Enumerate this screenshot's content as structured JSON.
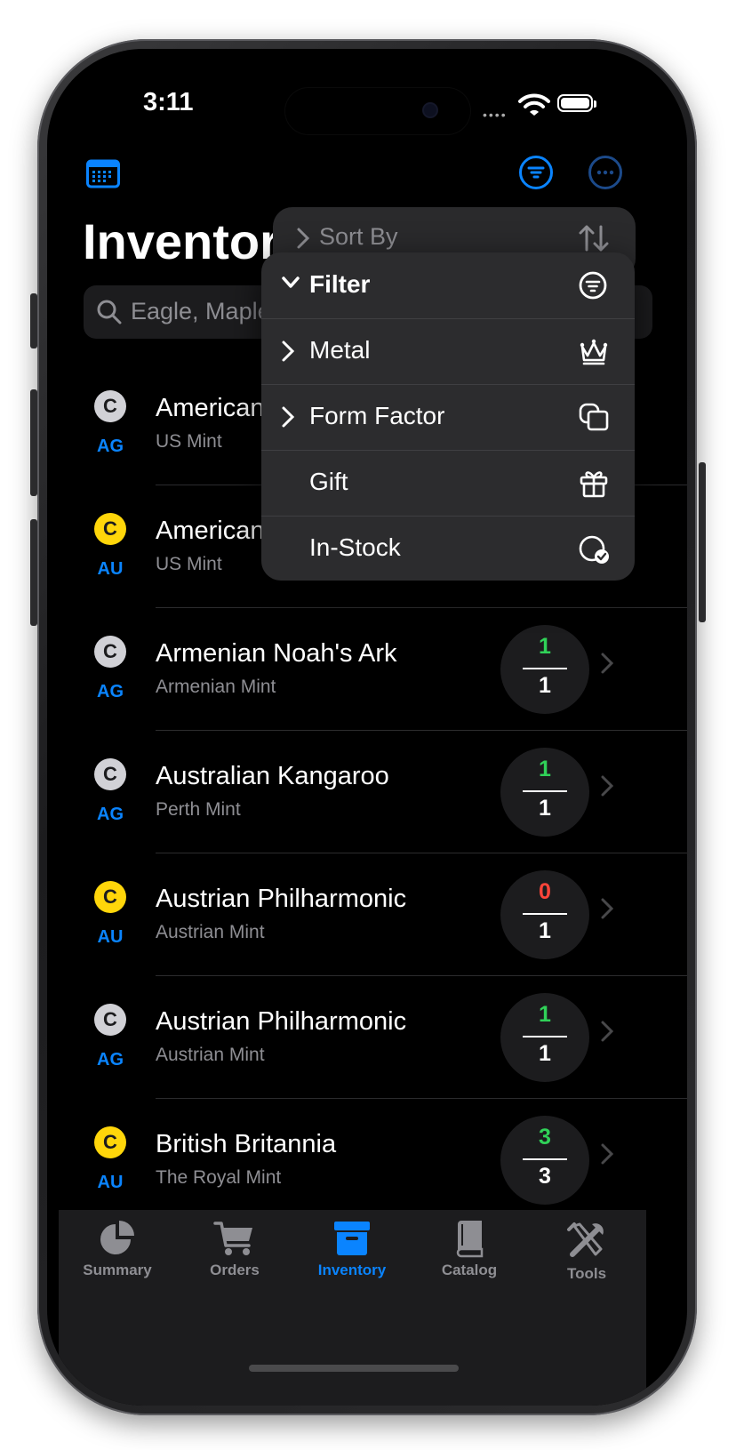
{
  "status": {
    "time": "3:11",
    "dots": "••••"
  },
  "header": {
    "title": "Inventory",
    "search_placeholder": "Eagle, Maple"
  },
  "menu": {
    "sort_label": "Sort By",
    "items": [
      {
        "label": "Filter",
        "icon": "filter-circle-icon"
      },
      {
        "label": "Metal",
        "icon": "crown-icon"
      },
      {
        "label": "Form Factor",
        "icon": "squares-icon"
      },
      {
        "label": "Gift",
        "icon": "gift-icon"
      },
      {
        "label": "In-Stock",
        "icon": "circle-check-icon"
      }
    ]
  },
  "items": [
    {
      "badge": "C",
      "metal": "AG",
      "name": "American Eagle",
      "mint": "US Mint",
      "have": "",
      "total": ""
    },
    {
      "badge": "C",
      "metal": "AU",
      "name": "American Eagle",
      "mint": "US Mint",
      "have": "",
      "total": ""
    },
    {
      "badge": "C",
      "metal": "AG",
      "name": "Armenian Noah's Ark",
      "mint": "Armenian Mint",
      "have": "1",
      "total": "1"
    },
    {
      "badge": "C",
      "metal": "AG",
      "name": "Australian Kangaroo",
      "mint": "Perth Mint",
      "have": "1",
      "total": "1"
    },
    {
      "badge": "C",
      "metal": "AU",
      "name": "Austrian Philharmonic",
      "mint": "Austrian Mint",
      "have": "0",
      "total": "1"
    },
    {
      "badge": "C",
      "metal": "AG",
      "name": "Austrian Philharmonic",
      "mint": "Austrian Mint",
      "have": "1",
      "total": "1"
    },
    {
      "badge": "C",
      "metal": "AU",
      "name": "British Britannia",
      "mint": "The Royal Mint",
      "have": "3",
      "total": "3"
    }
  ],
  "tabs": [
    {
      "label": "Summary",
      "icon": "pie-chart-icon"
    },
    {
      "label": "Orders",
      "icon": "cart-icon"
    },
    {
      "label": "Inventory",
      "icon": "archive-box-icon"
    },
    {
      "label": "Catalog",
      "icon": "book-icon"
    },
    {
      "label": "Tools",
      "icon": "tools-icon"
    }
  ],
  "colors": {
    "accent": "#0a84ff",
    "positive": "#30d158",
    "negative": "#ff453a",
    "gold": "#ffd60a",
    "silver": "#d1d1d6"
  }
}
